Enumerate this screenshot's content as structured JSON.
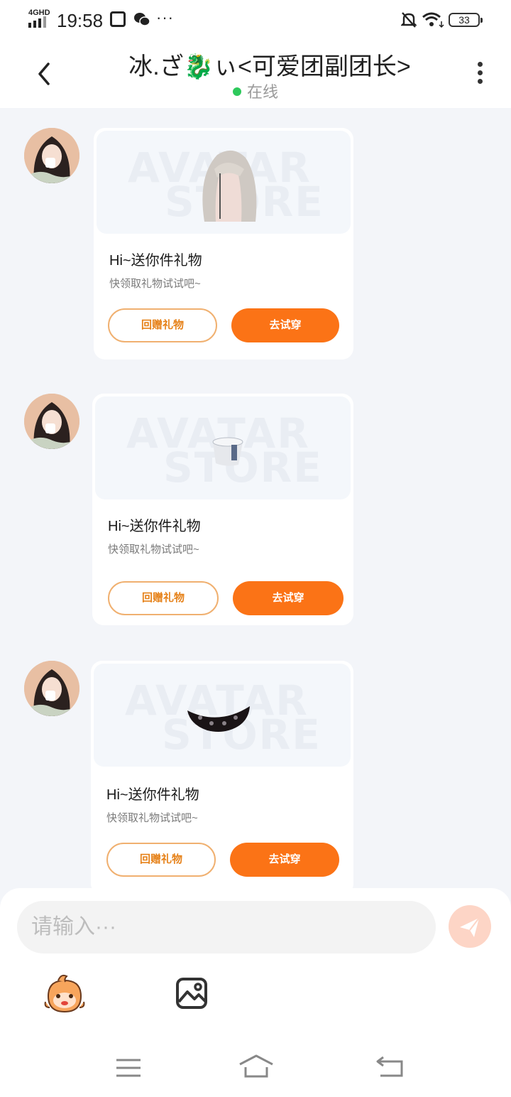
{
  "status_bar": {
    "network": "4GHD",
    "time": "19:58",
    "more": "···",
    "battery": "33"
  },
  "header": {
    "title": "冰.ざ🐉ぃ<可爱团副团长>",
    "status": "在线"
  },
  "messages": [
    {
      "item_icon": "wig-icon",
      "title": "Hi~送你件礼物",
      "subtitle": "快领取礼物试试吧~",
      "return_gift_label": "回赠礼物",
      "try_on_label": "去试穿",
      "watermark_1": "AVATAR",
      "watermark_2": "STORE"
    },
    {
      "item_icon": "hat-icon",
      "title": "Hi~送你件礼物",
      "subtitle": "快领取礼物试试吧~",
      "return_gift_label": "回赠礼物",
      "try_on_label": "去试穿",
      "watermark_1": "AVATAR",
      "watermark_2": "STORE"
    },
    {
      "item_icon": "mask-icon",
      "title": "Hi~送你件礼物",
      "subtitle": "快领取礼物试试吧~",
      "return_gift_label": "回赠礼物",
      "try_on_label": "去试穿",
      "watermark_1": "AVATAR",
      "watermark_2": "STORE"
    }
  ],
  "composer": {
    "placeholder": "请输入···"
  },
  "colors": {
    "accent": "#fb7316",
    "accent_outline": "#f0b070",
    "online": "#2ec95c",
    "background": "#f3f5f9"
  }
}
